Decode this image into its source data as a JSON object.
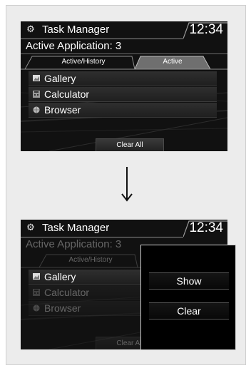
{
  "screen_before": {
    "header": {
      "title": "Task Manager",
      "clock": "12:34",
      "icon": "gear-icon"
    },
    "subtitle": "Active Application: 3",
    "tabs": [
      {
        "label": "Active/History",
        "selected": false
      },
      {
        "label": "Active",
        "selected": true
      }
    ],
    "apps": [
      {
        "label": "Gallery",
        "icon": "gallery-icon"
      },
      {
        "label": "Calculator",
        "icon": "calculator-icon"
      },
      {
        "label": "Browser",
        "icon": "browser-icon"
      }
    ],
    "clear_all_label": "Clear All"
  },
  "transition": {
    "icon": "down-arrow-icon"
  },
  "screen_after": {
    "header": {
      "title": "Task Manager",
      "clock": "12:34",
      "icon": "gear-icon"
    },
    "subtitle": "Active Application: 3",
    "tabs": [
      {
        "label": "Active/History"
      }
    ],
    "apps": [
      {
        "label": "Gallery",
        "icon": "gallery-icon",
        "highlighted": true
      },
      {
        "label": "Calculator",
        "icon": "calculator-icon",
        "highlighted": false
      },
      {
        "label": "Browser",
        "icon": "browser-icon",
        "highlighted": false
      }
    ],
    "clear_all_label": "Clear All",
    "popup": {
      "show_label": "Show",
      "clear_label": "Clear"
    }
  },
  "colors": {
    "screen_bg": "#111111",
    "frame_bg": "#ececec",
    "tab_active": "#6f6f6f",
    "text": "#ffffff"
  }
}
